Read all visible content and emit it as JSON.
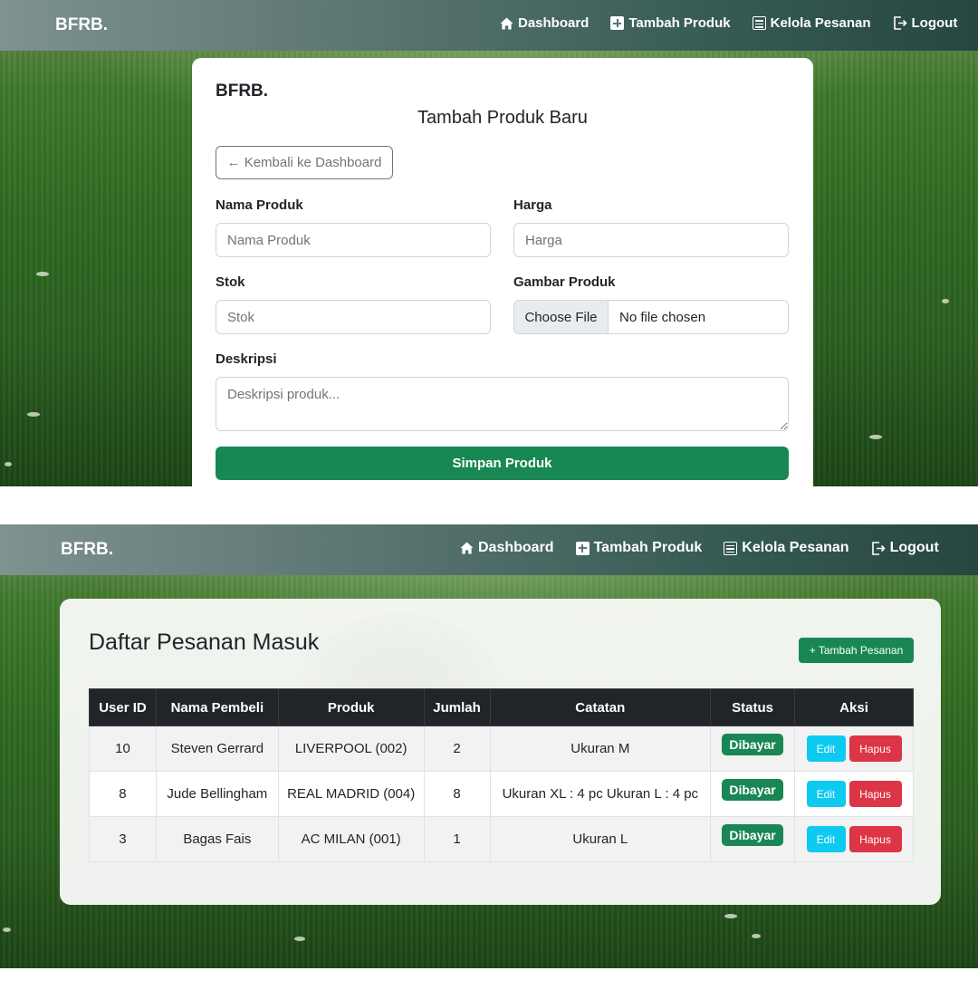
{
  "nav": {
    "brand": "BFRB.",
    "links": [
      {
        "label": "Dashboard",
        "icon": "home-icon"
      },
      {
        "label": "Tambah Produk",
        "icon": "plus-square-icon"
      },
      {
        "label": "Kelola Pesanan",
        "icon": "list-icon"
      },
      {
        "label": "Logout",
        "icon": "logout-icon"
      }
    ]
  },
  "form": {
    "brand": "BFRB.",
    "title": "Tambah Produk Baru",
    "back_label": "← Kembali ke Dashboard",
    "fields": {
      "name": {
        "label": "Nama Produk",
        "placeholder": "Nama Produk",
        "value": ""
      },
      "price": {
        "label": "Harga",
        "placeholder": "Harga",
        "value": ""
      },
      "stock": {
        "label": "Stok",
        "placeholder": "Stok",
        "value": ""
      },
      "image": {
        "label": "Gambar Produk",
        "button": "Choose File",
        "status": "No file chosen"
      },
      "description": {
        "label": "Deskripsi",
        "placeholder": "Deskripsi produk...",
        "value": ""
      }
    },
    "submit_label": "Simpan Produk"
  },
  "orders": {
    "title": "Daftar Pesanan Masuk",
    "add_label": "+ Tambah Pesanan",
    "columns": [
      "User ID",
      "Nama Pembeli",
      "Produk",
      "Jumlah",
      "Catatan",
      "Status",
      "Aksi"
    ],
    "rows": [
      {
        "user_id": "10",
        "buyer": "Steven Gerrard",
        "product": "LIVERPOOL (002)",
        "qty": "2",
        "note": "Ukuran M",
        "status": "Dibayar"
      },
      {
        "user_id": "8",
        "buyer": "Jude Bellingham",
        "product": "REAL MADRID (004)",
        "qty": "8",
        "note": "Ukuran XL : 4 pc Ukuran L : 4 pc",
        "status": "Dibayar"
      },
      {
        "user_id": "3",
        "buyer": "Bagas Fais",
        "product": "AC MILAN (001)",
        "qty": "1",
        "note": "Ukuran L",
        "status": "Dibayar"
      }
    ],
    "edit_label": "Edit",
    "delete_label": "Hapus"
  },
  "colors": {
    "primary_green": "#198754",
    "info": "#0dcaf0",
    "danger": "#dc3545",
    "table_header": "#212529"
  }
}
